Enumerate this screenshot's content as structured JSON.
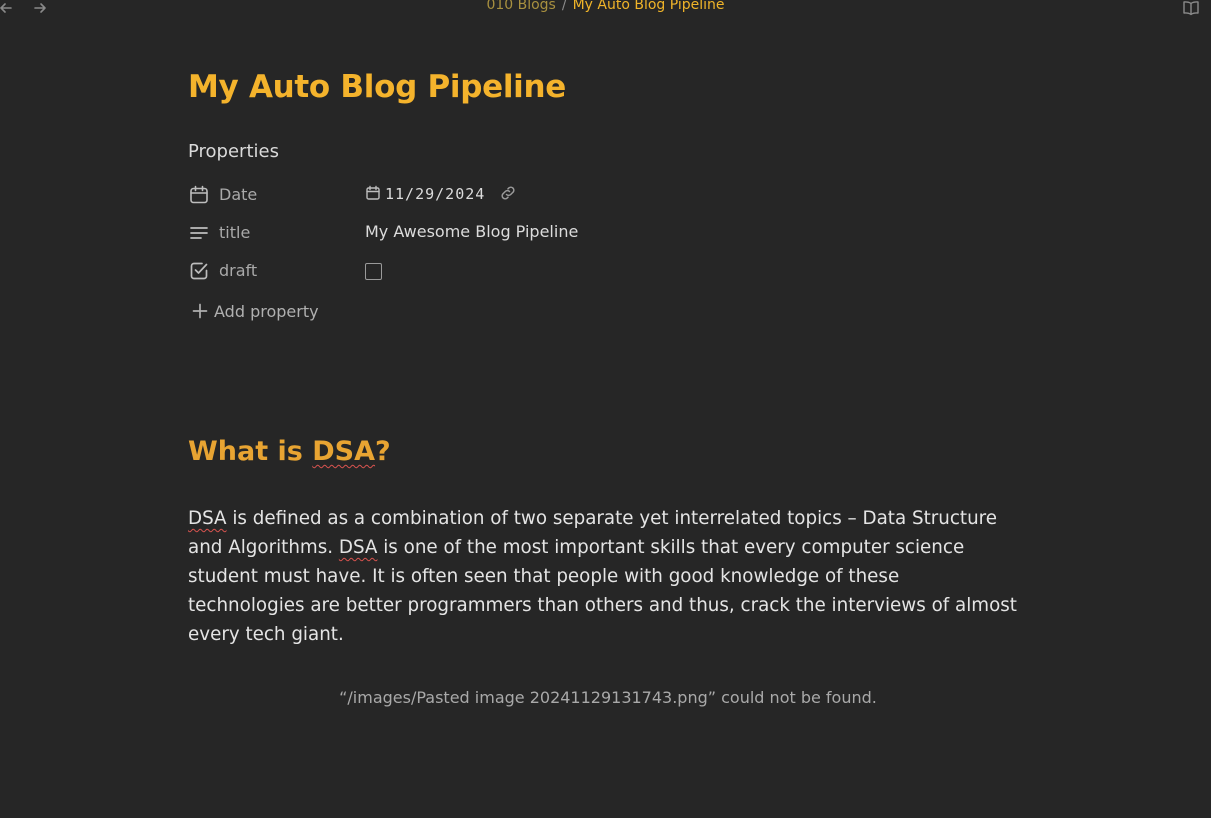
{
  "breadcrumb": {
    "parent": "010 Blogs",
    "separator": "/",
    "current": "My Auto Blog Pipeline"
  },
  "page": {
    "title": "My Auto Blog Pipeline"
  },
  "properties": {
    "heading": "Properties",
    "rows": [
      {
        "key": "Date",
        "value": "11/29/2024",
        "icon": "calendar-icon"
      },
      {
        "key": "title",
        "value": "My Awesome Blog Pipeline",
        "icon": "text-lines-icon"
      },
      {
        "key": "draft",
        "value": "",
        "icon": "checkbox-icon"
      }
    ],
    "draft_checked": false,
    "add_label": "Add property"
  },
  "body": {
    "heading_prefix": "What is ",
    "heading_term": "DSA",
    "heading_suffix": "?",
    "paragraph": {
      "term": "DSA",
      "part1": " is defined as a combination of two separate yet interrelated topics – Data Structure and Algorithms. ",
      "part2": " is one of the most important skills that every computer science student must have. It is often seen that people with good knowledge of these technologies are better programmers than others and thus, crack the interviews of almost every tech giant."
    },
    "missing_image": "“/images/Pasted image 20241129131743.png” could not be found."
  },
  "colors": {
    "background": "#262626",
    "title": "#f4b32c",
    "heading": "#e8a432",
    "breadcrumb_parent": "#a8903f",
    "breadcrumb_current": "#f0b429",
    "spellcheck": "#d9534f"
  }
}
